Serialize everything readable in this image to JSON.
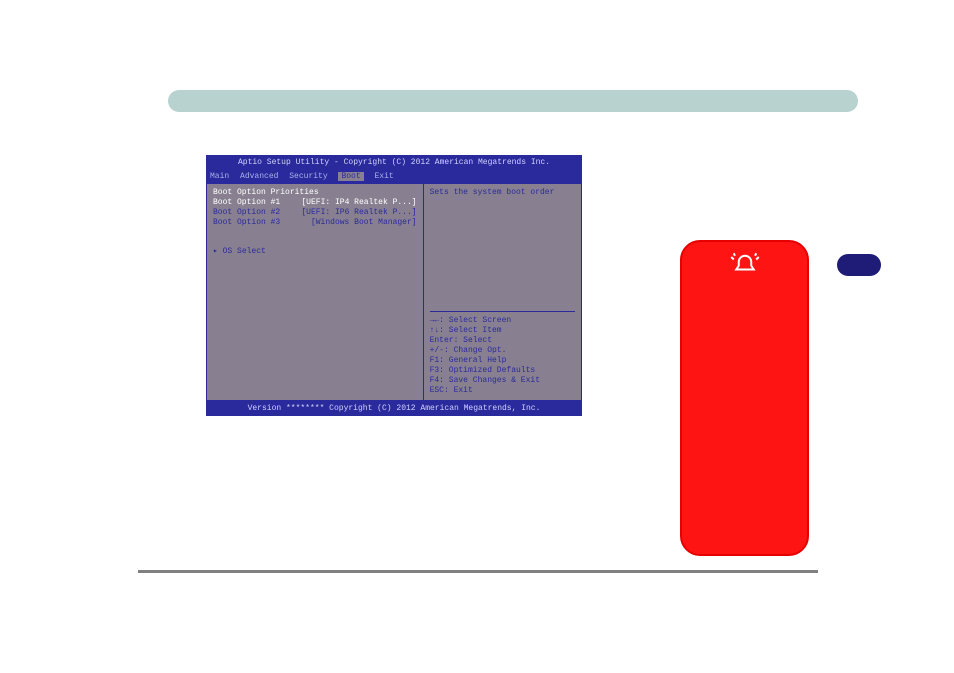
{
  "bios": {
    "header": "Aptio Setup Utility - Copyright (C) 2012 American Megatrends Inc.",
    "tabs": {
      "main": "Main",
      "advanced": "Advanced",
      "security": "Security",
      "boot": "Boot",
      "exit": "Exit"
    },
    "left": {
      "priorities_label": "Boot Option Priorities",
      "opt1_label": "Boot Option #1",
      "opt1_value": "[UEFI: IP4 Realtek P...]",
      "opt2_label": "Boot Option #2",
      "opt2_value": "[UEFI: IP6 Realtek P...]",
      "opt3_label": "Boot Option #3",
      "opt3_value": "[Windows Boot Manager]",
      "os_select": "▸ OS Select"
    },
    "right": {
      "hint": "Sets the system boot order",
      "nav1": "→←: Select Screen",
      "nav2": "↑↓: Select Item",
      "nav3": "Enter: Select",
      "nav4": "+/-: Change Opt.",
      "nav5": "F1: General Help",
      "nav6": "F3: Optimized Defaults",
      "nav7": "F4: Save Changes & Exit",
      "nav8": "ESC: Exit"
    },
    "footer": "Version ******** Copyright (C) 2012 American Megatrends, Inc."
  }
}
